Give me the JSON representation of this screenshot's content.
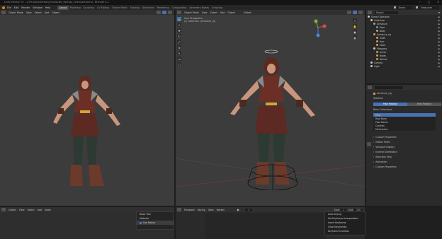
{
  "window": {
    "title": "Unity Mentor G7 – C:\\Projects\\Fantasy\\Character_Fantasy_character.blend - Blender 4.1",
    "controls": [
      "–",
      "□",
      "×"
    ]
  },
  "menubar": {
    "items": [
      "File",
      "Edit",
      "Render",
      "Window",
      "Help"
    ],
    "workspaces": [
      "Layout",
      "Modeling",
      "Sculpting",
      "UV Editing",
      "Texture Paint",
      "Shading",
      "Animation",
      "Rendering",
      "Compositing",
      "Geometry Nodes",
      "Scripting"
    ],
    "active_workspace": "Layout",
    "scene_label": "Scene",
    "view_layer_label": "ViewLayer"
  },
  "left_viewport": {
    "editor_type": "Object Mode",
    "menu": [
      "View",
      "Select",
      "Add",
      "Object"
    ],
    "bottom_menu": [
      "Object",
      "View",
      "Select",
      "Add",
      "Node"
    ],
    "options_label": "Use Nodes"
  },
  "right_viewport": {
    "mode": "Object Mode",
    "menu": [
      "View",
      "Select",
      "Add",
      "Object"
    ],
    "overlay_text_1": "User Perspective",
    "overlay_text_2": "(1) Collection | Armature_rig",
    "transform_global": "Global",
    "gizmo_x_color": "#e04a4a",
    "gizmo_y_color": "#7ab83f",
    "gizmo_z_color": "#4a86e0"
  },
  "outliner": {
    "search_placeholder": "Search",
    "rows": [
      {
        "label": "Scene Collection",
        "indent": 0,
        "color": "#c9c9c9"
      },
      {
        "label": "Collection",
        "indent": 1,
        "color": "#c9c9c9"
      },
      {
        "label": "Armature",
        "indent": 2,
        "color": "#d29a52"
      },
      {
        "label": "Pose",
        "indent": 3,
        "color": "#4aa0e0"
      },
      {
        "label": "Body",
        "indent": 3,
        "color": "#d29a52"
      },
      {
        "label": "Armature_rig",
        "indent": 2,
        "color": "#d29a52"
      },
      {
        "label": "Cloth",
        "indent": 3,
        "color": "#d29a52"
      },
      {
        "label": "Hair",
        "indent": 3,
        "color": "#d29a52"
      },
      {
        "label": "Mesh",
        "indent": 3,
        "color": "#d29a52"
      },
      {
        "label": "Weapons",
        "indent": 2,
        "color": "#c9c9c9"
      },
      {
        "label": "Armor",
        "indent": 3,
        "color": "#d29a52"
      },
      {
        "label": "Boots",
        "indent": 3,
        "color": "#d29a52"
      },
      {
        "label": "Gloves",
        "indent": 3,
        "color": "#d29a52"
      },
      {
        "label": "Camera",
        "indent": 1,
        "color": "#c9c9c9"
      },
      {
        "label": "Light",
        "indent": 1,
        "color": "#c9c9c9"
      }
    ]
  },
  "properties": {
    "object_name": "Armature_rig",
    "tabs": [
      "Pose Position",
      "Rest Position"
    ],
    "active_tab": "Pose Position",
    "sections": [
      "Skeleton",
      "Bone Collections"
    ],
    "list_rows": [
      "Main",
      "Root Bone",
      "Pose Bones",
      "Controls",
      "Mechanism"
    ],
    "collapsed_sections": [
      "Custom Properties",
      "Motion Paths",
      "Viewport Display",
      "Inverse Kinematics",
      "Selection Sets",
      "Animation",
      "Custom Properties"
    ]
  },
  "timeline": {
    "menu": [
      "Playback",
      "Keying",
      "View",
      "Marker"
    ],
    "frame_current": "1",
    "start_label": "Start",
    "start_value": "1",
    "end_label": "End",
    "end_value": "250"
  },
  "bottom_left_panel": {
    "title": "Node Tree",
    "item_1": "Material",
    "item_2": "Use Nodes"
  },
  "context_menu": {
    "items": [
      "Auto Keying",
      "Set Keyframe Interpolation",
      "Insert Keyframe",
      "Clear Keyframes",
      "Keyframe Insertion"
    ]
  },
  "colors": {
    "accent": "#4772b3",
    "viewport_bg": "#3c3c3c",
    "panel_bg": "#2b2b2b"
  }
}
